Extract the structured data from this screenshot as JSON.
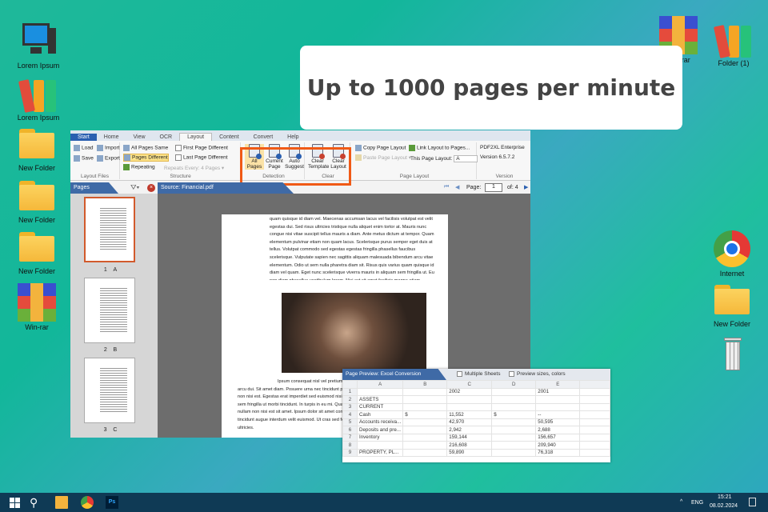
{
  "desktop": {
    "left_icons": [
      "Lorem Ipsum",
      "Lorem Ipsum",
      "New Folder",
      "New Folder",
      "New Folder",
      "Win-rar"
    ],
    "right_icons": {
      "winrar": "Win-rar",
      "folder1": "Folder (1)",
      "internet": "Internet",
      "new_folder": "New Folder"
    }
  },
  "callout": "Up to 1000 pages per minute",
  "app": {
    "tabs": [
      "Start",
      "Home",
      "View",
      "OCR",
      "Layout",
      "Content",
      "Convert",
      "Help"
    ],
    "layout_files": {
      "load": "Load",
      "import": "Import",
      "save": "Save",
      "export": "Export",
      "caption": "Layout Files"
    },
    "structure": {
      "all_same": "All Pages Same",
      "different": "Pages Different",
      "repeating": "Repeating",
      "first_diff": "First Page Different",
      "last_diff": "Last Page Different",
      "repeats_label": "Repeats Every:",
      "repeats_value": "4 Pages",
      "caption": "Structure"
    },
    "detection": {
      "all_pages": [
        "All",
        "Pages"
      ],
      "current_page": [
        "Current",
        "Page"
      ],
      "auto_suggest": [
        "Auto",
        "Suggest"
      ],
      "caption": "Detection"
    },
    "clear": {
      "clear_template": [
        "Clear",
        "Template"
      ],
      "clear_layout": [
        "Clear",
        "Layout"
      ],
      "caption": "Clear"
    },
    "page_layout": {
      "copy": "Copy Page Layout",
      "paste": "Paste Page Layout",
      "link": "Link Layout to Pages...",
      "this_label": "This Page Layout:",
      "this_value": "A",
      "caption": "Page Layout"
    },
    "version": {
      "product": "PDF2XL Enterprise",
      "version": "Version 6.5.7.2",
      "caption": "Version"
    },
    "pages_panel": {
      "title": "Pages",
      "thumbs": [
        {
          "num": "1",
          "letter": "A"
        },
        {
          "num": "2",
          "letter": "B"
        },
        {
          "num": "3",
          "letter": "C"
        }
      ]
    },
    "source": {
      "title": "Source: Financial.pdf",
      "page_label": "Page:",
      "page_value": "1",
      "of": "of: 4"
    },
    "doc_text_1": "quam quisque id diam vel. Maecenas accumsan lacus vel facilisis volutpat est velit egestas dui. Sed risus ultricies tristique nulla aliquet enim tortor at. Mauris nunc congue nisi vitae suscipit tellus mauris a diam. Ante metus dictum at tempor. Quam elementum pulvinar etiam non quam lacus. Scelerisque purus semper eget duis at tellus. Volutpat commodo sed egestas egestas fringilla phasellus faucibus scelerisque. Vulputate sapien nec sagittis aliquam malesuada bibendum arcu vitae elementum. Odio ut sem nulla pharetra diam sit. Risus quis varius quam quisque id diam vel quam. Eget nunc scelerisque viverra mauris in aliquam sem fringilla ut. Eu non diam phasellus vestibulum lorem. Nisi est sit amet facilisis magna etiam.",
    "doc_text_2": "Ipsum consequat nisl vel pretium lectus quam id. Ut libero volutpat sed cras ornare arcu dui. Sit amet diam. Posuere urna nec tincidunt praesent semper feugiat nibh sed. In eget nullam non nisi est. Egestas erat imperdiet sed euismod nisi porta mollis. Scelerisque viverra mauris in aliquam sem fringilla ut morbi tincidunt. In turpis in eu mi. Quam lacus suspendisse faucibus interdum posuere. Ut nullam non nisi est sit amet. Ipsum dolor sit amet consectetur adipiscing. Sed neque convallis. Ut morbi tincidunt augue interdum velit euismod. Ut cras sed felis eget velit. Suscipit adipiscing bibendum est ultricies."
  },
  "excel": {
    "title": "Page Preview: Excel Conversion",
    "multiple_sheets": "Multiple Sheets",
    "preview_sizes": "Preview sizes, colors",
    "columns": [
      "",
      "A",
      "B",
      "C",
      "D",
      "E",
      ""
    ],
    "rows": [
      [
        "1",
        "",
        "",
        "2002",
        "",
        "2001",
        ""
      ],
      [
        "2",
        "ASSETS",
        "",
        "",
        "",
        "",
        ""
      ],
      [
        "3",
        "CURRENT",
        "",
        "",
        "",
        "",
        ""
      ],
      [
        "4",
        "Cash",
        "$",
        "11,552",
        "$",
        "--",
        ""
      ],
      [
        "5",
        "Accounts receiva...",
        "",
        "42,970",
        "",
        "50,595",
        ""
      ],
      [
        "6",
        "Deposits and pre...",
        "",
        "2,942",
        "",
        "2,688",
        ""
      ],
      [
        "7",
        "Inventory",
        "",
        "159,144",
        "",
        "156,657",
        ""
      ],
      [
        "8",
        "",
        "",
        "216,608",
        "",
        "209,940",
        ""
      ],
      [
        "9",
        "PROPERTY, PL...",
        "",
        "59,890",
        "",
        "76,318",
        ""
      ]
    ]
  },
  "taskbar": {
    "lang": "ENG",
    "time": "15:21",
    "date": "08.02.2024"
  }
}
